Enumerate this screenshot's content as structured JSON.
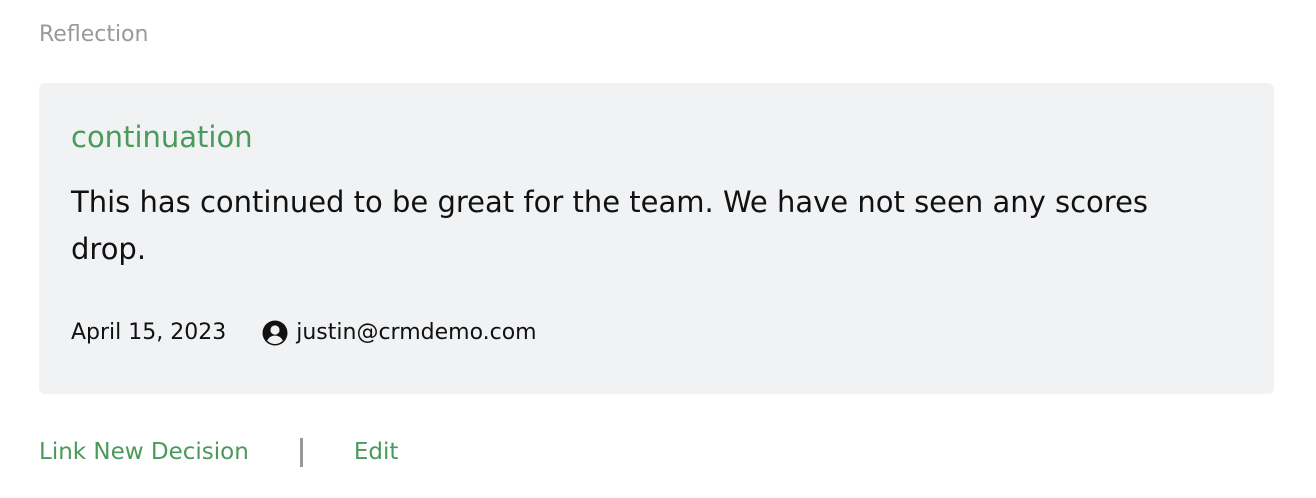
{
  "section": {
    "label": "Reflection"
  },
  "card": {
    "title": "continuation",
    "body": "This has continued to be great for the team. We have not seen any scores drop.",
    "date": "April 15, 2023",
    "user_email": "justin@crmdemo.com",
    "user_icon": "user-circle-icon"
  },
  "actions": {
    "link_new_decision": "Link New Decision",
    "edit": "Edit"
  },
  "colors": {
    "accent": "#4a9a5a",
    "card_bg": "#f1f2f4",
    "muted": "#999999"
  }
}
